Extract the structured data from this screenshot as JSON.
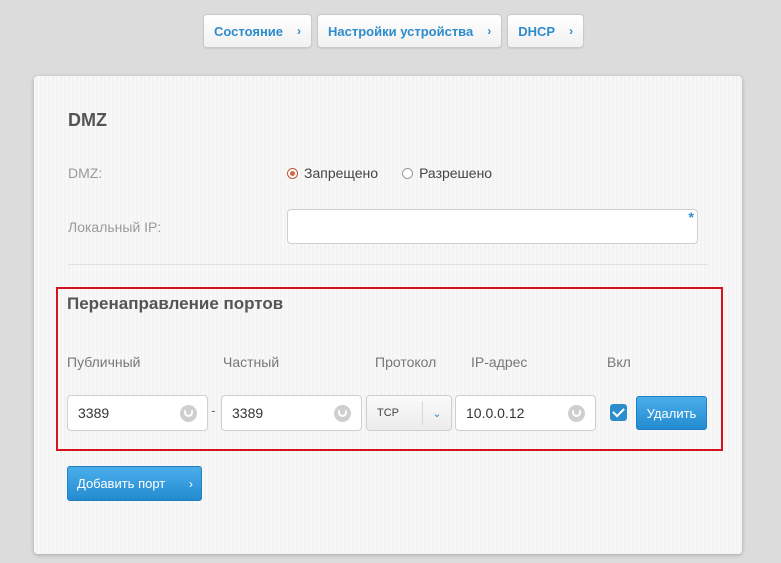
{
  "breadcrumb": {
    "items": [
      {
        "label": "Состояние"
      },
      {
        "label": "Настройки устройства"
      },
      {
        "label": "DHCP"
      }
    ],
    "chevron": "›"
  },
  "dmz": {
    "heading": "DMZ",
    "mode_label": "DMZ:",
    "options": [
      {
        "label": "Запрещено",
        "selected": true
      },
      {
        "label": "Разрешено",
        "selected": false
      }
    ],
    "local_ip_label": "Локальный IP:",
    "local_ip_value": "",
    "required_mark": "*"
  },
  "port_forwarding": {
    "heading": "Перенаправление портов",
    "columns": {
      "public": "Публичный",
      "private": "Частный",
      "protocol": "Протокол",
      "ip": "IP-адрес",
      "enabled": "Вкл"
    },
    "rows": [
      {
        "public": "3389",
        "private": "3389",
        "protocol": "TCP",
        "ip": "10.0.0.12",
        "enabled": true
      }
    ],
    "range_separator": "-",
    "delete_label": "Удалить",
    "add_label": "Добавить порт",
    "add_chevron": "›",
    "select_arrow": "⌄"
  },
  "colors": {
    "accent": "#2d8ccc",
    "highlight_border": "#d6131f",
    "radio_selected": "#d8693f"
  },
  "icons": {
    "field_icon": "smiley-icon",
    "breadcrumb_arrow": "chevron-right-icon"
  }
}
